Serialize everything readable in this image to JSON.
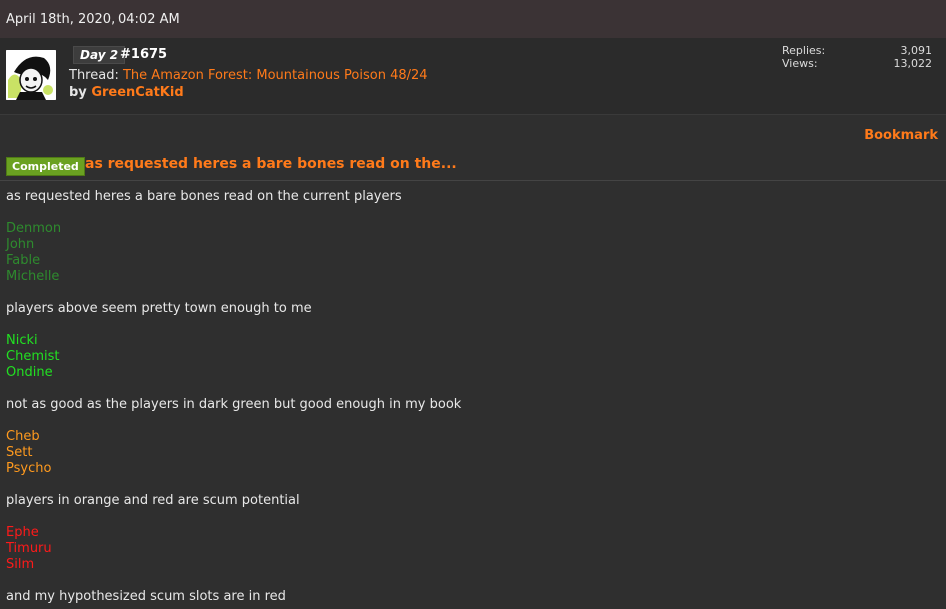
{
  "header": {
    "date": "April 18th, 2020,",
    "time": "04:02 AM"
  },
  "thread": {
    "day": "Day 2",
    "post_number": "#1675",
    "thread_label": "Thread:",
    "thread_title": "The Amazon Forest: Mountainous Poison 48/24",
    "by_label": "by",
    "author": "GreenCatKid",
    "stats": {
      "replies_label": "Replies:",
      "replies": "3,091",
      "views_label": "Views:",
      "views": "13,022"
    }
  },
  "post": {
    "bookmark": "Bookmark",
    "badge": "Completed",
    "title": "as requested heres a bare bones read on the...",
    "intro": "as requested heres a bare bones read on the current players",
    "dark_green": [
      "Denmon",
      "John",
      "Fable",
      "Michelle"
    ],
    "dark_green_note": "players above seem pretty town enough to me",
    "light_green": [
      "Nicki",
      "Chemist",
      "Ondine"
    ],
    "light_green_note": "not as good as the players in dark green but good enough in my book",
    "orange": [
      "Cheb",
      "Sett",
      "Psycho"
    ],
    "orange_note": "players in orange and red are scum potential",
    "red": [
      "Ephe",
      "Timuru",
      "Silm"
    ],
    "red_note": "and my hypothesized scum slots are in red"
  },
  "colors": {
    "accent": "#ff7a1a",
    "dark_green": "#2e8b2e",
    "light_green": "#22e022",
    "orange": "#ff9a1e",
    "red": "#ff1a1a",
    "badge": "#6aa121"
  }
}
